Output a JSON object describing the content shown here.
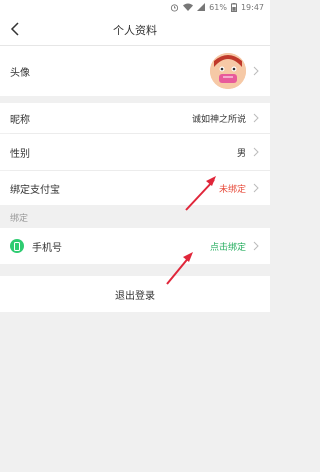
{
  "status_bar": {
    "battery": "61%",
    "time": "19:47"
  },
  "header": {
    "title": "个人资料"
  },
  "profile": {
    "avatar_label": "头像",
    "nickname_label": "昵称",
    "nickname_value": "诚如神之所说",
    "gender_label": "性别",
    "gender_value": "男",
    "alipay_label": "绑定支付宝",
    "alipay_value": "未绑定"
  },
  "binding": {
    "section_label": "绑定",
    "phone_label": "手机号",
    "phone_value": "点击绑定"
  },
  "logout_label": "退出登录",
  "colors": {
    "unbound": "#e74c3c",
    "bind_link": "#27ae60",
    "accent_arrow": "#e0263a"
  }
}
